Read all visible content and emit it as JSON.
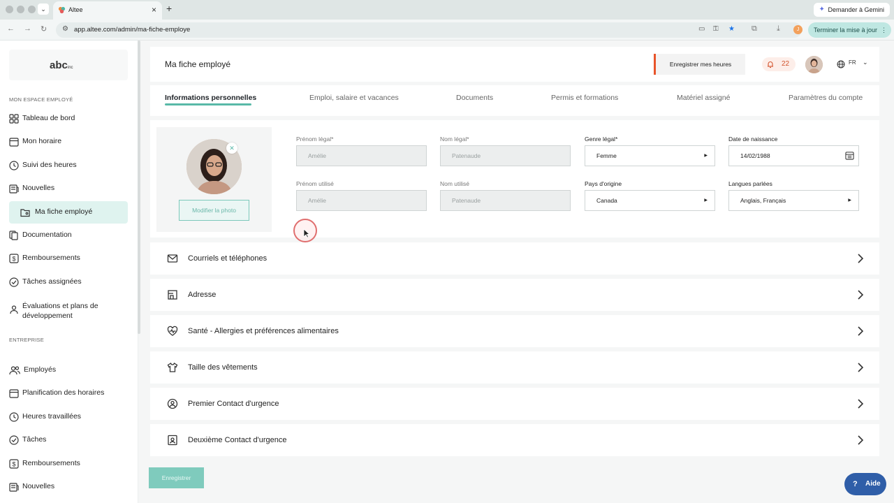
{
  "browser": {
    "tab_title": "Altee",
    "gemini_label": "Demander à Gemini",
    "url": "app.altee.com/admin/ma-fiche-employe",
    "update_label": "Terminer la mise à jour",
    "profile_initial": "J"
  },
  "sidebar": {
    "logo_text": "abc",
    "logo_suffix": "inc",
    "section1": "MON ESPACE EMPLOYÉ",
    "items1": [
      {
        "label": "Tableau de bord",
        "icon": "dashboard-icon"
      },
      {
        "label": "Mon horaire",
        "icon": "calendar-icon"
      },
      {
        "label": "Suivi des heures",
        "icon": "clock-icon"
      },
      {
        "label": "Nouvelles",
        "icon": "news-icon"
      },
      {
        "label": "Ma fiche employé",
        "icon": "folder-user-icon",
        "active": true
      },
      {
        "label": "Documentation",
        "icon": "documents-icon"
      },
      {
        "label": "Remboursements",
        "icon": "dollar-icon"
      },
      {
        "label": "Tâches assignées",
        "icon": "check-circle-icon"
      },
      {
        "label": "Évaluations et plans de développement",
        "icon": "person-icon"
      }
    ],
    "section2": "ENTREPRISE",
    "items2": [
      {
        "label": "Employés",
        "icon": "users-icon"
      },
      {
        "label": "Planification des horaires",
        "icon": "calendar-icon"
      },
      {
        "label": "Heures travaillées",
        "icon": "clock-icon"
      },
      {
        "label": "Tâches",
        "icon": "check-circle-icon"
      },
      {
        "label": "Remboursements",
        "icon": "dollar-icon"
      },
      {
        "label": "Nouvelles",
        "icon": "news-icon"
      }
    ]
  },
  "header": {
    "title": "Ma fiche employé",
    "hours_button": "Enregistrer mes heures",
    "notif_count": "22",
    "language": "FR"
  },
  "tabs": [
    {
      "label": "Informations personnelles",
      "active": true
    },
    {
      "label": "Emploi, salaire et vacances"
    },
    {
      "label": "Documents"
    },
    {
      "label": "Permis et formations"
    },
    {
      "label": "Matériel assigné"
    },
    {
      "label": "Paramètres du compte"
    }
  ],
  "photo": {
    "button": "Modifier la photo"
  },
  "form": {
    "legal_first_name": {
      "label": "Prénom légal*",
      "value": "Amélie"
    },
    "legal_last_name": {
      "label": "Nom légal*",
      "value": "Patenaude"
    },
    "legal_gender": {
      "label": "Genre légal*",
      "value": "Femme"
    },
    "birth_date": {
      "label": "Date de naissance",
      "value": "14/02/1988"
    },
    "used_first_name": {
      "label": "Prénom utilisé",
      "value": "Amélie"
    },
    "used_last_name": {
      "label": "Nom utilisé",
      "value": "Patenaude"
    },
    "origin_country": {
      "label": "Pays d'origine",
      "value": "Canada"
    },
    "languages": {
      "label": "Langues parlées",
      "value": "Anglais, Français"
    }
  },
  "sections": [
    {
      "label": "Courriels et téléphones",
      "icon": "mail-icon"
    },
    {
      "label": "Adresse",
      "icon": "address-icon"
    },
    {
      "label": "Santé - Allergies et préférences alimentaires",
      "icon": "heart-icon"
    },
    {
      "label": "Taille des vêtements",
      "icon": "shirt-icon"
    },
    {
      "label": "Premier Contact d'urgence",
      "icon": "contact-circle-icon"
    },
    {
      "label": "Deuxième Contact d'urgence",
      "icon": "contact-card-icon"
    }
  ],
  "footer": {
    "save_button": "Enregistrer",
    "help_button": "Aide"
  },
  "colors": {
    "accent": "#58b9a8",
    "active_nav_bg": "#dff3ef",
    "orange": "#e8542a",
    "help_blue": "#2f5ea8"
  }
}
